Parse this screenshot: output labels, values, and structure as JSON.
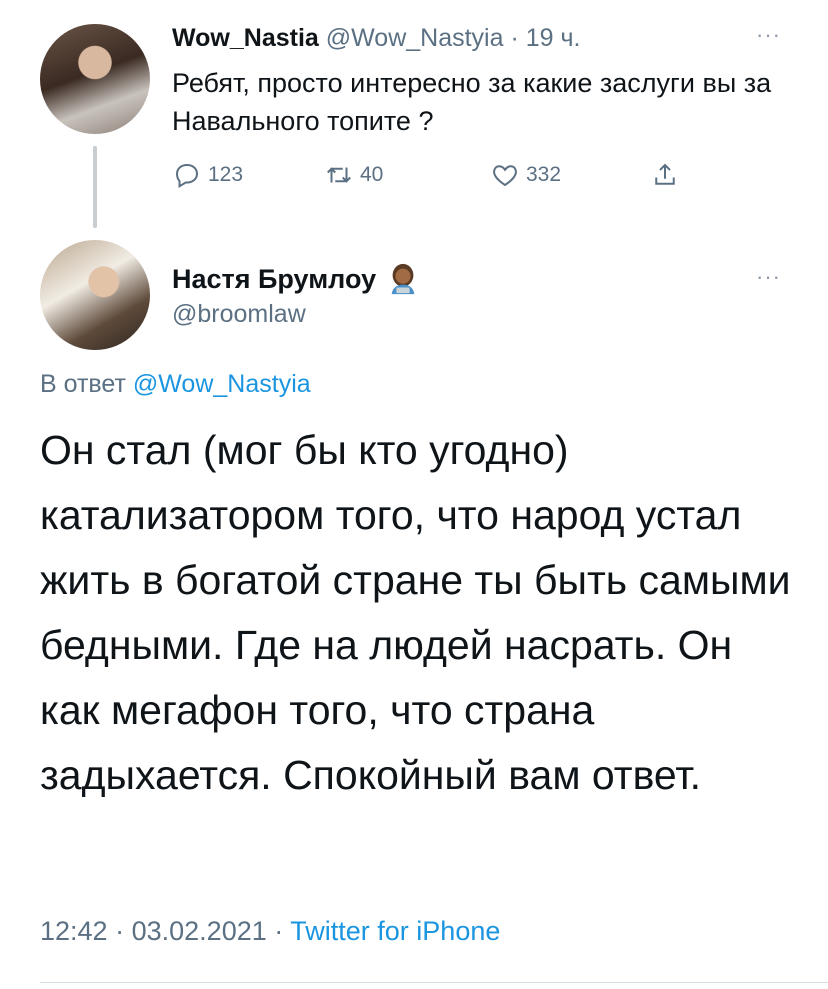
{
  "parent_tweet": {
    "display_name": "Wow_Nastia",
    "handle": "@Wow_Nastyia",
    "separator": "·",
    "time_ago": "19 ч.",
    "text": "Ребят, просто интересно за какие заслуги вы за Навального топите ?",
    "more_label": "···",
    "actions": {
      "reply_count": "123",
      "retweet_count": "40",
      "like_count": "332"
    },
    "icons": [
      "reply-icon",
      "retweet-icon",
      "like-icon",
      "share-icon"
    ]
  },
  "main_tweet": {
    "display_name": "Настя Брумлоу",
    "name_emoji": "woman-technologist-emoji",
    "handle": "@broomlaw",
    "more_label": "···",
    "reply_prefix": "В ответ",
    "reply_mention": "@Wow_Nastyia",
    "text": "Он стал (мог бы кто угодно) катализатором того, что народ устал жить в богатой стране ты быть самыми бедными. Где на людей насрать. Он как мегафон того, что страна задыхается. Спокойный вам ответ.",
    "time": "12:42",
    "date": "03.02.2021",
    "dot": "·",
    "source": "Twitter for iPhone"
  },
  "colors": {
    "text_primary": "#0f1419",
    "text_secondary": "#5b7083",
    "link": "#1b95e0",
    "thread_line": "#c7cdd1"
  }
}
